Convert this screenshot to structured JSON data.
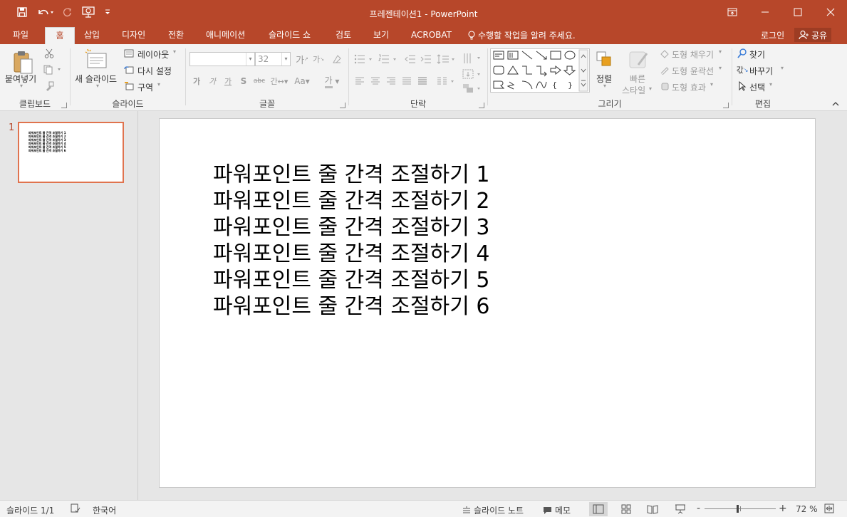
{
  "window": {
    "title": "프레젠테이션1 - PowerPoint",
    "login": "로그인",
    "share": "공유",
    "tell_me": "수행할 작업을 알려 주세요."
  },
  "tabs": [
    {
      "label": "파일"
    },
    {
      "label": "홈"
    },
    {
      "label": "삽입"
    },
    {
      "label": "디자인"
    },
    {
      "label": "전환"
    },
    {
      "label": "애니메이션"
    },
    {
      "label": "슬라이드 쇼"
    },
    {
      "label": "검토"
    },
    {
      "label": "보기"
    },
    {
      "label": "ACROBAT"
    }
  ],
  "ribbon": {
    "clipboard": {
      "label": "클립보드",
      "paste": "붙여넣기"
    },
    "slides": {
      "label": "슬라이드",
      "new_slide": "새 슬라이드",
      "layout": "레이아웃",
      "reset": "다시 설정",
      "section": "구역"
    },
    "font": {
      "label": "글꼴",
      "font_name": "",
      "font_size": "32"
    },
    "paragraph": {
      "label": "단락"
    },
    "drawing": {
      "label": "그리기",
      "arrange": "정렬",
      "quick_styles": "빠른 스타일",
      "quick_styles_1": "빠른",
      "quick_styles_2": "스타일",
      "shape_fill": "도형 채우기",
      "shape_outline": "도형 윤곽선",
      "shape_effects": "도형 효과"
    },
    "editing": {
      "label": "편집",
      "find": "찾기",
      "replace": "바꾸기",
      "select": "선택"
    }
  },
  "thumbnail": {
    "number": "1"
  },
  "slide": {
    "lines": [
      "파워포인트 줄 간격 조절하기 1",
      "파워포인트 줄 간격 조절하기 2",
      "파워포인트 줄 간격 조절하기 3",
      "파워포인트 줄 간격 조절하기 4",
      "파워포인트 줄 간격 조절하기 5",
      "파워포인트 줄 간격 조절하기 6"
    ]
  },
  "status": {
    "slide_counter": "슬라이드 1/1",
    "language": "한국어",
    "notes": "슬라이드 노트",
    "comments": "메모",
    "zoom": "72 %",
    "zoom_minus": "-",
    "zoom_plus": "+",
    "zoom_fraction": 0.46
  },
  "colors": {
    "accent": "#b7472a",
    "thumb_border": "#e0734e"
  }
}
